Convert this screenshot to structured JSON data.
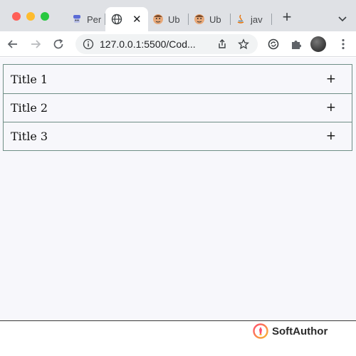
{
  "browser": {
    "tabs": [
      {
        "label": "Per",
        "icon": "tab-favicon-mascot",
        "active": false
      },
      {
        "label": "",
        "icon": "globe-icon",
        "active": true
      },
      {
        "label": "Ub",
        "icon": "avatar-face-icon",
        "active": false
      },
      {
        "label": "Ub",
        "icon": "avatar-face-icon",
        "active": false
      },
      {
        "label": "jav",
        "icon": "java-icon",
        "active": false
      }
    ],
    "new_tab_label": "+",
    "address": "127.0.0.1:5500/Cod..."
  },
  "accordion": {
    "items": [
      {
        "title": "Title 1",
        "toggle": "+"
      },
      {
        "title": "Title 2",
        "toggle": "+"
      },
      {
        "title": "Title 3",
        "toggle": "+"
      }
    ]
  },
  "footer": {
    "brand": "SoftAuthor"
  },
  "colors": {
    "accordion_border": "#6f8e86",
    "page_background": "#f7f7fb",
    "brand_logo_gradient": [
      "#ff4f6d",
      "#f7b733"
    ]
  }
}
